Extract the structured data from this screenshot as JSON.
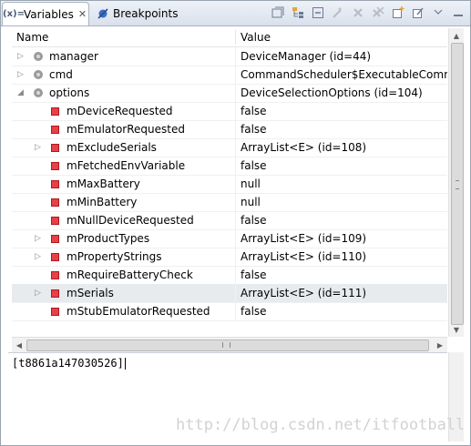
{
  "tabs": [
    {
      "icon": "(x)=",
      "label": "Variables",
      "close": "✕"
    },
    {
      "icon": "breakpoints-icon",
      "label": "Breakpoints"
    }
  ],
  "columns": {
    "name": "Name",
    "value": "Value"
  },
  "rows": [
    {
      "name": "manager",
      "value": "DeviceManager  (id=44)",
      "level": 0,
      "expander": "collapsed",
      "icon": "field-dot-icon"
    },
    {
      "name": "cmd",
      "value": "CommandScheduler$ExecutableComma",
      "level": 0,
      "expander": "collapsed",
      "icon": "field-dot-icon"
    },
    {
      "name": "options",
      "value": "DeviceSelectionOptions  (id=104)",
      "level": 0,
      "expander": "expanded",
      "icon": "field-dot-icon"
    },
    {
      "name": "mDeviceRequested",
      "value": "false",
      "level": 1,
      "expander": "none",
      "icon": "private-field-icon"
    },
    {
      "name": "mEmulatorRequested",
      "value": "false",
      "level": 1,
      "expander": "none",
      "icon": "private-field-icon"
    },
    {
      "name": "mExcludeSerials",
      "value": "ArrayList<E>  (id=108)",
      "level": 1,
      "expander": "collapsed",
      "icon": "private-field-icon"
    },
    {
      "name": "mFetchedEnvVariable",
      "value": "false",
      "level": 1,
      "expander": "none",
      "icon": "private-field-icon"
    },
    {
      "name": "mMaxBattery",
      "value": "null",
      "level": 1,
      "expander": "none",
      "icon": "private-field-icon"
    },
    {
      "name": "mMinBattery",
      "value": "null",
      "level": 1,
      "expander": "none",
      "icon": "private-field-icon"
    },
    {
      "name": "mNullDeviceRequested",
      "value": "false",
      "level": 1,
      "expander": "none",
      "icon": "private-field-icon"
    },
    {
      "name": "mProductTypes",
      "value": "ArrayList<E>  (id=109)",
      "level": 1,
      "expander": "collapsed",
      "icon": "private-field-icon"
    },
    {
      "name": "mPropertyStrings",
      "value": "ArrayList<E>  (id=110)",
      "level": 1,
      "expander": "collapsed",
      "icon": "private-field-icon"
    },
    {
      "name": "mRequireBatteryCheck",
      "value": "false",
      "level": 1,
      "expander": "none",
      "icon": "private-field-icon"
    },
    {
      "name": "mSerials",
      "value": "ArrayList<E>  (id=111)",
      "level": 1,
      "expander": "collapsed",
      "icon": "private-field-icon",
      "selected": true
    },
    {
      "name": "mStubEmulatorRequested",
      "value": "false",
      "level": 1,
      "expander": "none",
      "icon": "private-field-icon"
    }
  ],
  "detail": {
    "text": "[t8861a147030526]"
  },
  "watermark": "http://blog.csdn.net/itfootball"
}
